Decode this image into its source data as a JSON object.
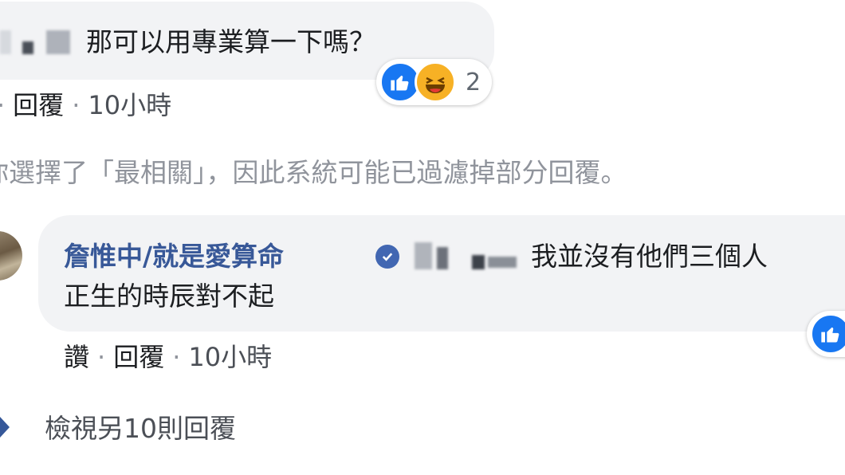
{
  "comment1": {
    "text": "那可以用專業算一下嗎？",
    "reactions": {
      "count": "2",
      "icons": [
        "like-icon",
        "haha-icon"
      ]
    },
    "actions": {
      "reply": "回覆",
      "time": "10小時"
    }
  },
  "filter_notice": "你選擇了「最相關」，因此系統可能已過濾掉部分回覆。",
  "comment2": {
    "author": "詹惟中/就是愛算命",
    "text_line1": "我並沒有他們三個人",
    "text_line2": "正生的時辰對不起",
    "actions": {
      "like": "讚",
      "reply": "回覆",
      "time": "10小時"
    },
    "reactions": {
      "icons": [
        "like-icon"
      ]
    }
  },
  "view_more": "檢視另10則回覆",
  "colors": {
    "link": "#385898",
    "bubble": "#f2f3f5",
    "meta": "#90949c",
    "like": "#1877f2"
  }
}
